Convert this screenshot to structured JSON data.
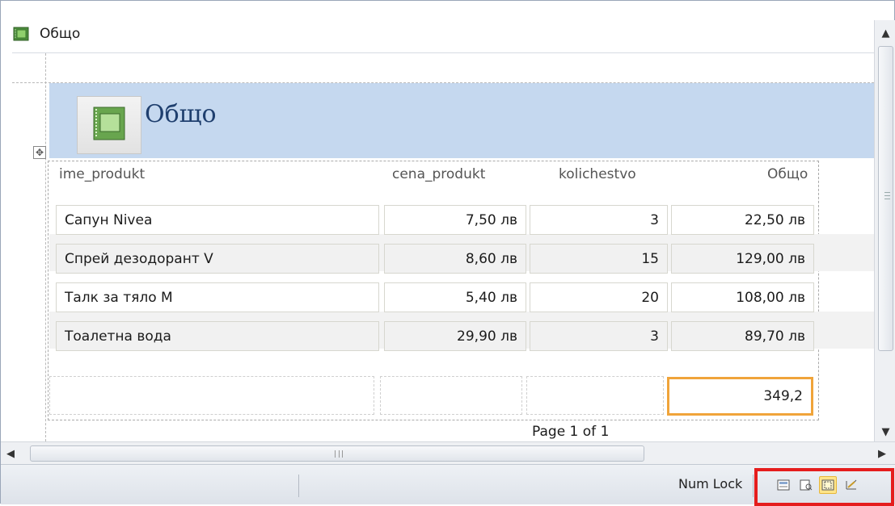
{
  "window": {
    "tab_title": "Общо",
    "tab_icon": "report-icon"
  },
  "report": {
    "title": "Общо",
    "logo_icon": "report-logo-icon",
    "columns": [
      {
        "label": "ime_produkt"
      },
      {
        "label": "cena_produkt"
      },
      {
        "label": "kolichestvo"
      },
      {
        "label": "Общо"
      }
    ],
    "rows": [
      {
        "ime_produkt": "Сапун Nivea",
        "cena_produkt": "7,50 лв",
        "kolichestvo": "3",
        "obshto": "22,50 лв"
      },
      {
        "ime_produkt": "Спрей дезодорант V",
        "cena_produkt": "8,60 лв",
        "kolichestvo": "15",
        "obshto": "129,00 лв"
      },
      {
        "ime_produkt": "Талк за тяло М",
        "cena_produkt": "5,40 лв",
        "kolichestvo": "20",
        "obshto": "108,00 лв"
      },
      {
        "ime_produkt": "Тоалетна вода",
        "cena_produkt": "29,90 лв",
        "kolichestvo": "3",
        "obshto": "89,70 лв"
      }
    ],
    "total": "349,2",
    "page_footer": "Page 1 of 1"
  },
  "statusbar": {
    "num_lock": "Num Lock",
    "views": [
      {
        "name": "report-view-icon",
        "active": false
      },
      {
        "name": "print-preview-icon",
        "active": false
      },
      {
        "name": "layout-view-icon",
        "active": true
      },
      {
        "name": "design-view-icon",
        "active": false
      }
    ]
  },
  "colors": {
    "header_band": "#c5d8ef",
    "title_text": "#1f3f6e",
    "selection_border": "#f0a43a",
    "highlight_box": "#e51d1d",
    "active_view": "#ffe489"
  }
}
